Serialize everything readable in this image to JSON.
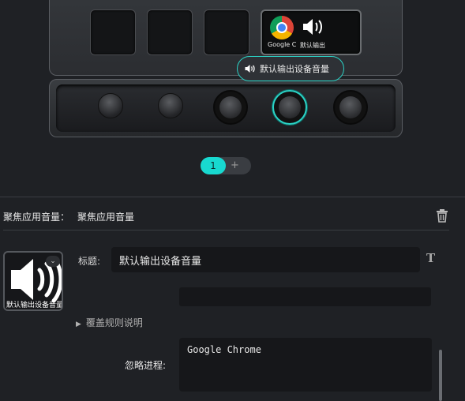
{
  "device": {
    "key4": {
      "label_left": "Google C",
      "label_right": "默认输出"
    },
    "tooltip": "默认输出设备音量"
  },
  "pager": {
    "current": "1",
    "add": "+"
  },
  "section": {
    "heading": "聚焦应用音量：",
    "value": "聚焦应用音量"
  },
  "preview": {
    "caption": "默认输出设备音量",
    "chevron": "⌄"
  },
  "form": {
    "title_label": "标题:",
    "title_value": "默认输出设备音量",
    "text_style_icon": "T",
    "rules_toggle": "覆盖规则说明",
    "ignore_label": "忽略进程:",
    "ignore_value": "Google Chrome"
  },
  "icons": [
    "chrome-icon",
    "speaker-icon",
    "trash-icon",
    "text-style-icon",
    "chevron-down-icon",
    "expand-triangle-icon"
  ],
  "colors": {
    "accent": "#18d9d0",
    "background": "#1f2125",
    "input_bg": "#16171a"
  }
}
